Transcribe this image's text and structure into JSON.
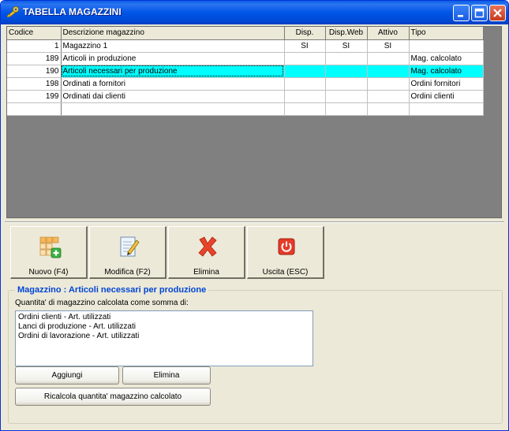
{
  "window": {
    "title": "TABELLA MAGAZZINI",
    "title_icon": "app-key-icon",
    "controls": [
      "minimize-icon",
      "maximize-icon",
      "close-icon"
    ]
  },
  "grid": {
    "columns": [
      "Codice",
      "Descrizione magazzino",
      "Disp.",
      "Disp.Web",
      "Attivo",
      "Tipo"
    ],
    "rows": [
      {
        "code": "1",
        "desc": "Magazzino 1",
        "disp": "SI",
        "dispweb": "SI",
        "attivo": "SI",
        "tipo": ""
      },
      {
        "code": "189",
        "desc": "Articoli in produzione",
        "disp": "",
        "dispweb": "",
        "attivo": "",
        "tipo": "Mag. calcolato"
      },
      {
        "code": "190",
        "desc": "Articoli necessari per produzione",
        "disp": "",
        "dispweb": "",
        "attivo": "",
        "tipo": "Mag. calcolato",
        "selected": true
      },
      {
        "code": "198",
        "desc": "Ordinati a fornitori",
        "disp": "",
        "dispweb": "",
        "attivo": "",
        "tipo": "Ordini fornitori"
      },
      {
        "code": "199",
        "desc": "Ordinati dai clienti",
        "disp": "",
        "dispweb": "",
        "attivo": "",
        "tipo": "Ordini clienti"
      }
    ],
    "selected_color": "#00ffff"
  },
  "toolbar": {
    "nuovo": "Nuovo (F4)",
    "modifica": "Modifica (F2)",
    "elimina": "Elimina",
    "uscita": "Uscita (ESC)"
  },
  "detail": {
    "title": "Magazzino : Articoli necessari per produzione",
    "label": "Quantita' di magazzino calcolata come somma di:",
    "items": [
      "Ordini clienti - Art. utilizzati",
      "Lanci di produzione - Art. utilizzati",
      "Ordini di lavorazione - Art. utilizzati"
    ],
    "aggiungi": "Aggiungi",
    "elimina": "Elimina",
    "ricalcola": "Ricalcola quantita' magazzino calcolato"
  },
  "colors": {
    "titlebar": "#0055e6",
    "group_title": "#0046d5",
    "grid_background": "#808080"
  }
}
